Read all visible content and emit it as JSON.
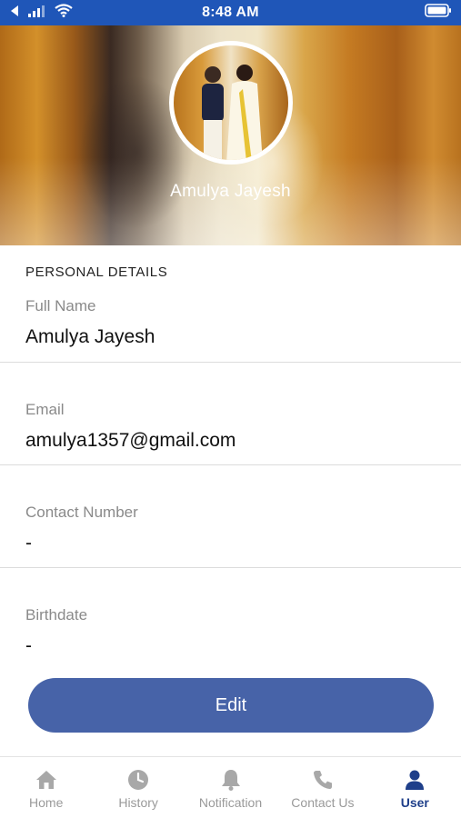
{
  "status_bar": {
    "time": "8:48 AM",
    "icons": [
      "back-arrow-icon",
      "signal-icon",
      "wifi-icon",
      "battery-icon"
    ]
  },
  "profile": {
    "name": "Amulya Jayesh",
    "avatar": "profile-photo"
  },
  "personal_details": {
    "section_title": "PERSONAL DETAILS",
    "fields": [
      {
        "label": "Full Name",
        "value": "Amulya Jayesh"
      },
      {
        "label": "Email",
        "value": "amulya1357@gmail.com"
      },
      {
        "label": "Contact Number",
        "value": "-"
      },
      {
        "label": "Birthdate",
        "value": "-"
      }
    ]
  },
  "actions": {
    "edit_label": "Edit"
  },
  "bottom_nav": {
    "items": [
      {
        "label": "Home",
        "icon": "home-icon"
      },
      {
        "label": "History",
        "icon": "clock-icon"
      },
      {
        "label": "Notification",
        "icon": "bell-icon"
      },
      {
        "label": "Contact Us",
        "icon": "phone-icon"
      },
      {
        "label": "User",
        "icon": "user-icon",
        "active": true
      }
    ]
  },
  "colors": {
    "status_bar": "#1f56b8",
    "accent": "#4763a8",
    "nav_active": "#1f3f8a",
    "nav_inactive": "#9a9a9a"
  }
}
